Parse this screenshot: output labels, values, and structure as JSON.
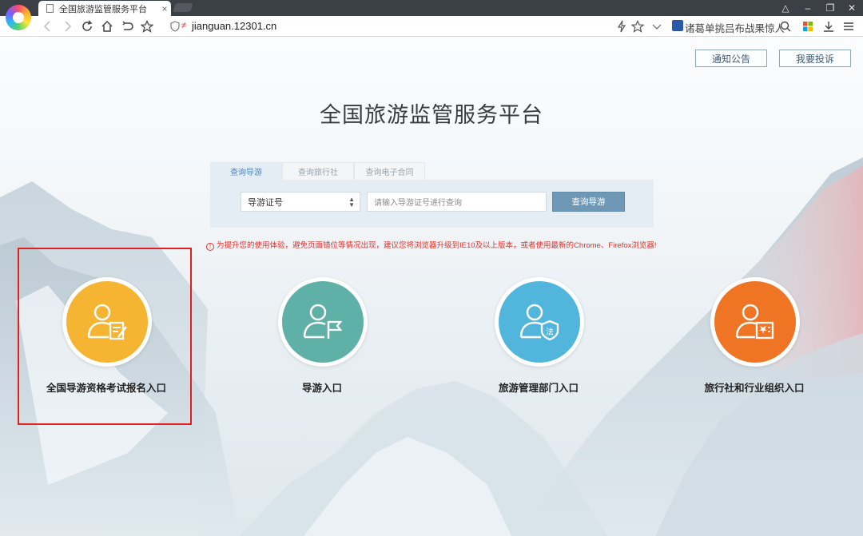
{
  "browser": {
    "tab_title": "全国旅游监管服务平台",
    "tab_close": "×",
    "url": "jianguan.12301.cn",
    "news_ticker": "诸葛单挑吕布战果惊人"
  },
  "header": {
    "notice_label": "通知公告",
    "complaint_label": "我要投诉",
    "site_title": "全国旅游监管服务平台"
  },
  "search": {
    "tabs": [
      {
        "label": "查询导游",
        "active": true
      },
      {
        "label": "查询旅行社",
        "active": false
      },
      {
        "label": "查询电子合同",
        "active": false
      }
    ],
    "select_value": "导游证号",
    "input_placeholder": "请输入导游证号进行查询",
    "button_label": "查询导游"
  },
  "warning": {
    "icon": "!",
    "text": "为提升您的使用体验，避免页面错位等情况出现，建议您将浏览器升级到IE10及以上版本，或者使用最新的Chrome、Firefox浏览器!"
  },
  "entries": [
    {
      "label": "全国导游资格考试报名入口",
      "color": "#f5b432",
      "icon": "exam-register-icon"
    },
    {
      "label": "导游入口",
      "color": "#5fb0a6",
      "icon": "guide-flag-icon"
    },
    {
      "label": "旅游管理部门入口",
      "color": "#52b6dc",
      "icon": "law-shield-icon"
    },
    {
      "label": "旅行社和行业组织入口",
      "color": "#ef7524",
      "icon": "agency-book-icon"
    }
  ],
  "colors": {
    "accent": "#4b87bd",
    "search_button": "#6f98b6",
    "warning": "#e0322c",
    "highlight": "#e02020"
  }
}
